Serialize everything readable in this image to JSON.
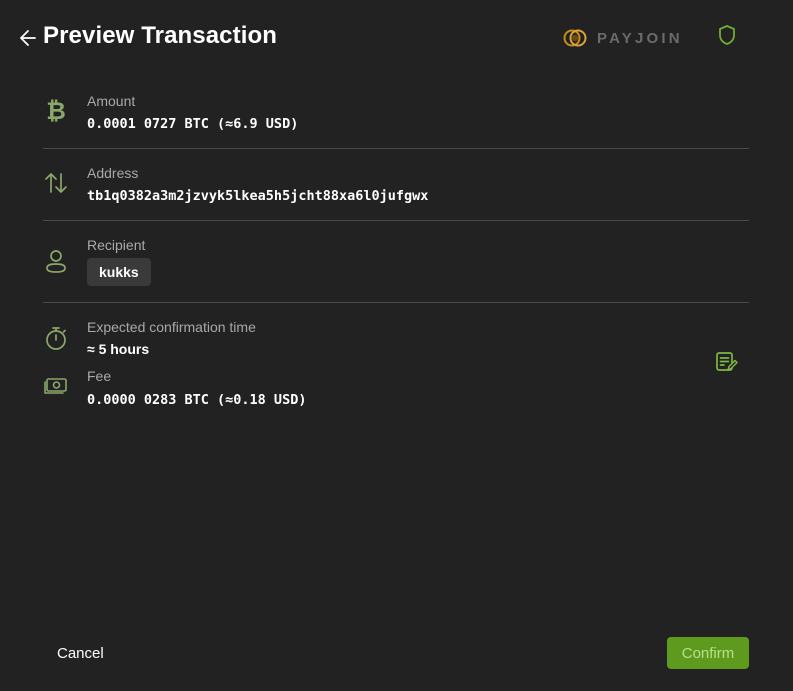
{
  "header": {
    "title": "Preview Transaction",
    "payjoin_label": "PAYJOIN",
    "back_icon": "arrow-left-icon",
    "shield_icon": "shield-icon"
  },
  "amount": {
    "label": "Amount",
    "value": "0.0001 0727 BTC (≈6.9 USD)",
    "icon": "bitcoin-icon"
  },
  "address": {
    "label": "Address",
    "value": "tb1q0382a3m2jzvyk5lkea5h5jcht88xa6l0jufgwx",
    "icon": "arrows-up-down-icon"
  },
  "recipient": {
    "label": "Recipient",
    "value": "kukks",
    "icon": "person-icon"
  },
  "confirmation": {
    "label": "Expected confirmation time",
    "value": "≈ 5 hours",
    "icon": "stopwatch-icon"
  },
  "fee": {
    "label": "Fee",
    "value": "0.0000 0283 BTC (≈0.18 USD)",
    "icon": "banknote-icon",
    "edit_icon": "edit-note-icon"
  },
  "footer": {
    "cancel_label": "Cancel",
    "confirm_label": "Confirm"
  },
  "colors": {
    "background": "#222222",
    "accent": "#5d9a1e",
    "icon_green": "#8aa86a",
    "divider": "#4a4a4a"
  }
}
